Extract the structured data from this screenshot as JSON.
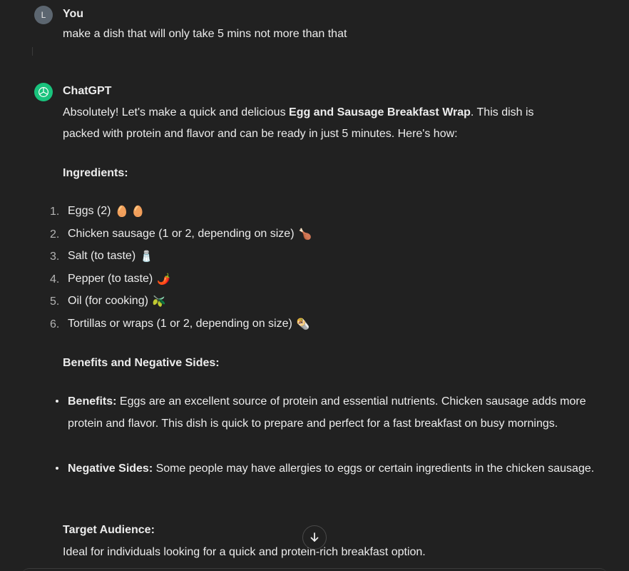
{
  "user": {
    "avatar_letter": "L",
    "name": "You",
    "message": "make a dish that will only take 5 mins not more than that"
  },
  "assistant": {
    "name": "ChatGPT",
    "intro_part1": "Absolutely! Let's make a quick and delicious ",
    "intro_bold": "Egg and Sausage Breakfast Wrap",
    "intro_part2": ". This dish is",
    "intro_line2": "packed with protein and flavor and can be ready in just 5 minutes. Here's how:",
    "ingredients_heading": "Ingredients:",
    "ingredients": [
      {
        "num": "1.",
        "text": "Eggs (2)",
        "emoji": "🥚 🥚"
      },
      {
        "num": "2.",
        "text": "Chicken sausage (1 or 2, depending on size)",
        "emoji": "🍗"
      },
      {
        "num": "3.",
        "text": "Salt (to taste)",
        "emoji": "🧂"
      },
      {
        "num": "4.",
        "text": "Pepper (to taste)",
        "emoji": "🌶️"
      },
      {
        "num": "5.",
        "text": "Oil (for cooking)",
        "emoji": "🫒"
      },
      {
        "num": "6.",
        "text": "Tortillas or wraps (1 or 2, depending on size)",
        "emoji": "🌯"
      }
    ],
    "benefits_heading": "Benefits and Negative Sides:",
    "benefits_label": "Benefits:",
    "benefits_text": " Eggs are an excellent source of protein and essential nutrients. Chicken sausage adds more protein and flavor. This dish is quick to prepare and perfect for a fast breakfast on busy mornings.",
    "negative_label": "Negative Sides:",
    "negative_text": " Some people may have allergies to eggs or certain ingredients in the chicken sausage.",
    "audience_heading": "Target Audience:",
    "audience_text": "Ideal for individuals looking for a quick and protein-rich breakfast option."
  },
  "controls": {
    "scroll_down_icon": "arrow-down-icon"
  },
  "colors": {
    "background": "#212121",
    "text": "#ececec",
    "assistant_avatar": "#19c37d",
    "user_avatar": "#5c6670"
  }
}
